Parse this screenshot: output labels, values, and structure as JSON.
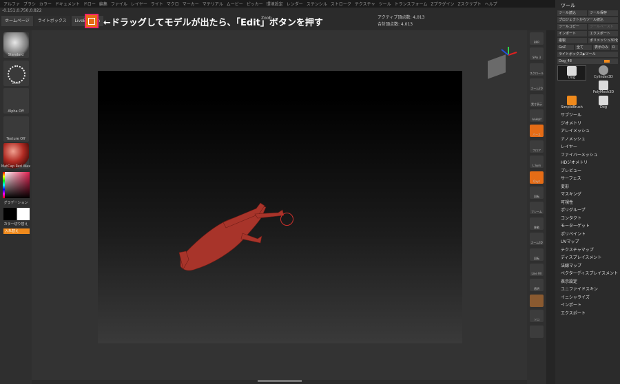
{
  "menu": [
    "アルファ",
    "ブラシ",
    "カラー",
    "ドキュメント",
    "ドロー",
    "編集",
    "ファイル",
    "レイヤー",
    "ライト",
    "マクロ",
    "マーカー",
    "マテリアル",
    "ムービー",
    "ピッカー",
    "環境設定",
    "レンダー",
    "ステンシル",
    "ストローク",
    "テクスチャ",
    "ツール",
    "トランスフォーム",
    "Zプラグイン",
    "Zスクリプト",
    "ヘルプ"
  ],
  "coords": "-0.151,0.750,0.822",
  "tabs": [
    {
      "label": "ホームページ"
    },
    {
      "label": "ライトボックス"
    },
    {
      "label": "LiveBoolean"
    }
  ],
  "toolbar": {
    "edit_label": "Edit",
    "zoob_label": "Zoob"
  },
  "annotation": "←ドラッグしてモデルが出たら、「Edit」ボタンを押す",
  "stats": {
    "active": "アクティブ頂点数: 4,013",
    "total": "合計頂点数: 4,013"
  },
  "left_panel": {
    "brush": "Standard",
    "stroke": "Dots",
    "alpha": "Alpha Off",
    "texture": "Texture Off",
    "material": "MatCap Red Wax",
    "gradient": "グラデーション",
    "swap": "カラー切り替え",
    "swap_button": "入れ替え"
  },
  "right_tools": [
    {
      "label": "BPR",
      "style": "normal"
    },
    {
      "label": "SPix 3",
      "style": "normal"
    },
    {
      "label": "スクロール",
      "style": "normal"
    },
    {
      "label": "ズーム2D",
      "style": "normal"
    },
    {
      "label": "実寸表示",
      "style": "normal"
    },
    {
      "label": "AAHalf",
      "style": "normal"
    },
    {
      "label": "パース",
      "style": "orange"
    },
    {
      "label": "フロア",
      "style": "normal"
    },
    {
      "label": "L.Sym",
      "style": "normal"
    },
    {
      "label": "Qxyz",
      "style": "orange"
    },
    {
      "label": "回転",
      "style": "normal"
    },
    {
      "label": "フレーム",
      "style": "normal"
    },
    {
      "label": "移動",
      "style": "normal"
    },
    {
      "label": "ズーム3D",
      "style": "normal"
    },
    {
      "label": "回転",
      "style": "normal"
    },
    {
      "label": "Line Fill",
      "style": "normal"
    },
    {
      "label": "透明",
      "style": "normal"
    },
    {
      "label": "",
      "style": "brown"
    },
    {
      "label": "ソロ",
      "style": "normal"
    },
    {
      "label": "",
      "style": "normal"
    }
  ],
  "tool_panel": {
    "title": "ツール",
    "rows": [
      [
        "ツール読込",
        "ツール保存"
      ],
      [
        "プロジェクトからツール読込"
      ],
      [
        "ツールコピー",
        "ツールペースト"
      ],
      [
        "インポート",
        "エクスポート"
      ],
      [
        "複製",
        "ポリメッシュ3D化"
      ],
      [
        "GoZ",
        "全て",
        "表示のみ",
        "R"
      ],
      [
        "ライトボックス▶ツール"
      ]
    ],
    "current": "Dog_48",
    "thumbs": [
      {
        "label": "Dog",
        "selected": true
      },
      {
        "label": "Cylinder3D",
        "selected": false
      },
      {
        "label": "PolyMesh3D",
        "selected": false
      },
      {
        "label": "SimpleBrush",
        "selected": false
      },
      {
        "label": "Dog",
        "selected": false
      }
    ],
    "sections": [
      "サブツール",
      "ジオメトリ",
      "アレイメッシュ",
      "ナノメッシュ",
      "レイヤー",
      "ファイバーメッシュ",
      "HDジオメトリ",
      "プレビュー",
      "サーフェス",
      "変形",
      "マスキング",
      "可視性",
      "ポリグループ",
      "コンタクト",
      "モーターゲット",
      "ポリペイント",
      "UVマップ",
      "テクスチャマップ",
      "ディスプレイスメント",
      "法線マップ",
      "ベクターディスプレイスメント",
      "表示設定",
      "ユニファイドスキン",
      "イニシャライズ",
      "インポート",
      "エクスポート"
    ]
  },
  "colors": {
    "accent": "#e56c16",
    "highlight": "#ff2468",
    "model": "#a8342a"
  }
}
